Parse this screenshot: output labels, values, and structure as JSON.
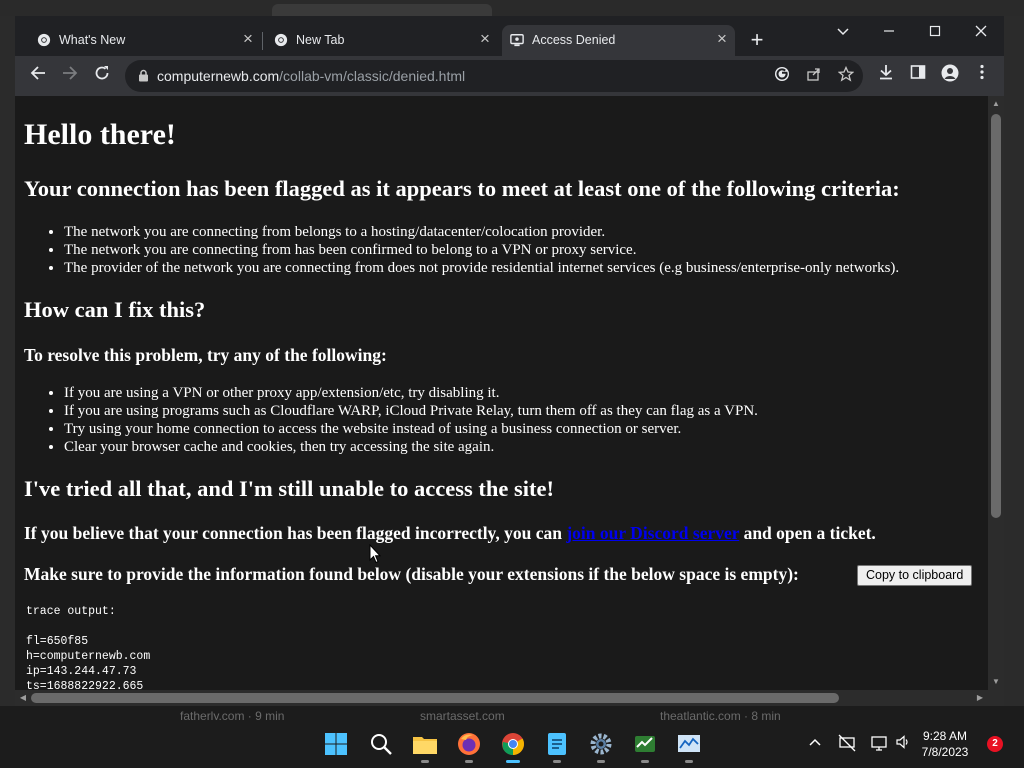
{
  "browser": {
    "tabs": [
      {
        "title": "What's New",
        "icon": "chrome-icon",
        "active": false
      },
      {
        "title": "New Tab",
        "icon": "chrome-icon",
        "active": false
      },
      {
        "title": "Access Denied",
        "icon": "collabvm-icon",
        "active": true
      }
    ],
    "close_glyph": "×",
    "new_tab_glyph": "+",
    "url_domain": "computernewb.com",
    "url_path": "/collab-vm/classic/denied.html"
  },
  "page": {
    "heading": "Hello there!",
    "flagged_heading": "Your connection has been flagged as it appears to meet at least one of the following criteria:",
    "criteria": [
      "The network you are connecting from belongs to a hosting/datacenter/colocation provider.",
      "The network you are connecting from has been confirmed to belong to a VPN or proxy service.",
      "The provider of the network you are connecting from does not provide residential internet services (e.g business/enterprise-only networks)."
    ],
    "fix_heading": "How can I fix this?",
    "resolve_heading": "To resolve this problem, try any of the following:",
    "fixes": [
      "If you are using a VPN or other proxy app/extension/etc, try disabling it.",
      "If you are using programs such as Cloudflare WARP, iCloud Private Relay, turn them off as they can flag as a VPN.",
      "Try using your home connection to access the website instead of using a business connection or server.",
      "Clear your browser cache and cookies, then try accessing the site again."
    ],
    "tried_heading": "I've tried all that, and I'm still unable to access the site!",
    "believe_prefix": "If you believe that your connection has been flagged incorrectly, you can ",
    "discord_link": "join our Discord server",
    "believe_suffix": " and open a ticket.",
    "provide_text": "Make sure to provide the information found below (disable your extensions if the below space is empty):",
    "copy_button": "Copy to clipboard",
    "trace_label": "trace output:",
    "trace_lines": [
      "fl=650f85",
      "h=computernewb.com",
      "ip=143.244.47.73",
      "ts=1688822922.665"
    ]
  },
  "desktop_behind": {
    "items": [
      "fatherly.com · 9 min",
      "smartasset.com",
      "theatlantic.com · 8 min"
    ]
  },
  "taskbar": {
    "apps": [
      "windows-start-icon",
      "search-icon",
      "file-explorer-icon",
      "firefox-icon",
      "chrome-icon",
      "notepad-icon",
      "settings-icon",
      "task-manager-icon",
      "resource-monitor-icon"
    ],
    "active_app": "chrome-icon",
    "time": "9:28 AM",
    "date": "7/8/2023",
    "notifications": "2"
  },
  "colors": {
    "page_background": "#1a1a1a",
    "link": "#0000ee",
    "accent": "#4cc2ff"
  }
}
